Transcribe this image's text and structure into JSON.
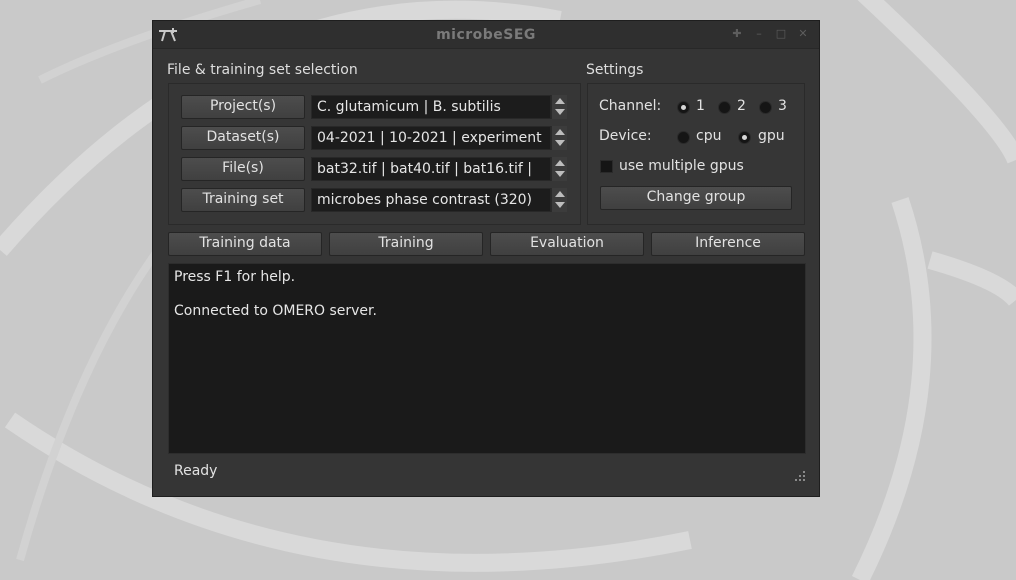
{
  "window": {
    "title": "microbeSEG",
    "controls": [
      "pin-icon",
      "minimize-icon",
      "maximize-icon",
      "close-icon"
    ]
  },
  "file_section": {
    "label": "File & training set selection",
    "rows": [
      {
        "button": "Project(s)",
        "value": "C. glutamicum | B. subtilis"
      },
      {
        "button": "Dataset(s)",
        "value": "04-2021 | 10-2021 | experiment"
      },
      {
        "button": "File(s)",
        "value": "bat32.tif | bat40.tif | bat16.tif |"
      },
      {
        "button": "Training set",
        "value": "microbes phase contrast (320)"
      }
    ]
  },
  "settings": {
    "label": "Settings",
    "channel_label": "Channel:",
    "channels": [
      {
        "label": "1",
        "selected": true
      },
      {
        "label": "2",
        "selected": false
      },
      {
        "label": "3",
        "selected": false
      }
    ],
    "device_label": "Device:",
    "devices": [
      {
        "label": "cpu",
        "selected": false
      },
      {
        "label": "gpu",
        "selected": true
      }
    ],
    "multi_gpu_label": "use multiple gpus",
    "multi_gpu_checked": false,
    "change_group_label": "Change group"
  },
  "tabs": [
    {
      "label": "Training data"
    },
    {
      "label": "Training"
    },
    {
      "label": "Evaluation"
    },
    {
      "label": "Inference"
    }
  ],
  "log": {
    "lines": [
      "Press F1 for help.",
      "Connected to OMERO server."
    ]
  },
  "status": "Ready",
  "colors": {
    "desktop": "#c9c9c9",
    "window": "#353535",
    "field": "#1c1c1c",
    "text": "#e2e2e2"
  }
}
